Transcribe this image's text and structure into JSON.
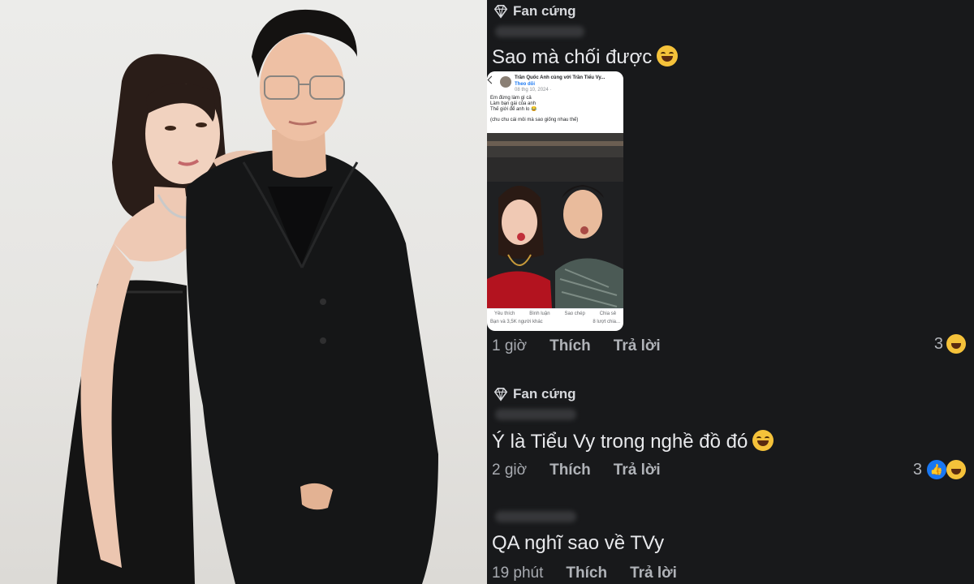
{
  "photo": {
    "alt": "Couple posing in black outfits"
  },
  "embedded_post": {
    "author_line": "Trần Quốc Anh cùng với Trần Tiểu Vy...",
    "follow_label": "Theo dõi",
    "date": "08 thg 10, 2024 · ",
    "body_lines": [
      "Em đừng làm gì cả",
      "Làm bạn gái của anh",
      "Thế giới để anh lo 😂",
      "",
      "(chu chu cái môi mà sao giống nhau thế)"
    ],
    "actions": [
      "Yêu thích",
      "Bình luận",
      "Sao chép",
      "Chia sẻ"
    ],
    "reactions_text": "Bạn và 3,5K người khác",
    "shares_text": "8 lượt chia..."
  },
  "comments": [
    {
      "badge": "Fan cứng",
      "text": "Sao mà chối được",
      "time": "1 giờ",
      "like_label": "Thích",
      "reply_label": "Trả lời",
      "reaction_count": "3"
    },
    {
      "badge": "Fan cứng",
      "text": "Ý là Tiểu Vy trong nghề đồ đó",
      "time": "2 giờ",
      "like_label": "Thích",
      "reply_label": "Trả lời",
      "reaction_count": "3"
    },
    {
      "text": "QA nghĩ sao về TVy",
      "time": "19 phút",
      "like_label": "Thích",
      "reply_label": "Trả lời"
    }
  ],
  "colors": {
    "panel_bg": "#18191b",
    "text": "#e4e6eb",
    "meta": "#b0b3b8",
    "like_blue": "#1877f2"
  }
}
